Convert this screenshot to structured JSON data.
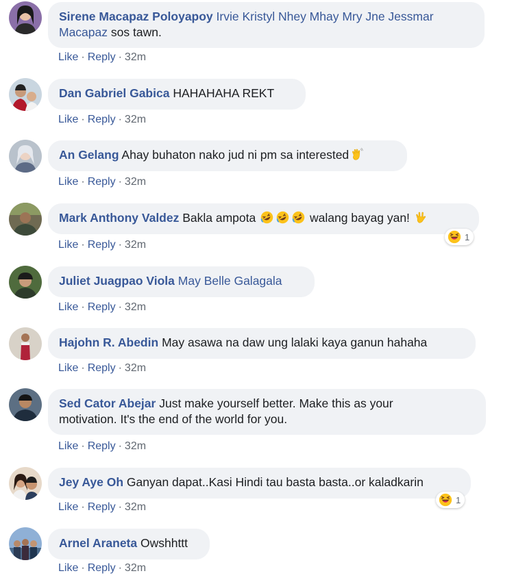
{
  "comments": [
    {
      "author": "Sirene Macapaz Poloyapoy",
      "tag": "Irvie Kristyl Nhey Mhay Mry Jne Jessmar Macapaz",
      "text": " sos tawn.",
      "like": "Like",
      "reply": "Reply",
      "time": "32m"
    },
    {
      "author": "Dan Gabriel Gabica",
      "text": "HAHAHAHA REKT",
      "like": "Like",
      "reply": "Reply",
      "time": "32m"
    },
    {
      "author": "An Gelang",
      "text": "Ahay buhaton nako jud ni pm sa interested",
      "emoji": "waving-hand",
      "like": "Like",
      "reply": "Reply",
      "time": "32m"
    },
    {
      "author": "Mark Anthony Valdez",
      "text_before": "Bakla ampota ",
      "emojis": [
        "rofl",
        "rofl",
        "rofl"
      ],
      "text_after": " walang bayag yan! ",
      "end_emoji": "love-you-gesture",
      "reaction": {
        "type": "haha",
        "count": "1"
      },
      "like": "Like",
      "reply": "Reply",
      "time": "32m"
    },
    {
      "author": "Juliet Juagpao Viola",
      "tag": "May Belle Galagala",
      "like": "Like",
      "reply": "Reply",
      "time": "32m"
    },
    {
      "author": "Hajohn R. Abedin",
      "text": "May asawa na daw ung lalaki kaya ganun hahaha",
      "like": "Like",
      "reply": "Reply",
      "time": "32m"
    },
    {
      "author": "Sed Cator Abejar",
      "text_line1": "Just make yourself better. Make this as your",
      "text_line2": "motivation. It's the end of the world for you.",
      "like": "Like",
      "reply": "Reply",
      "time": "32m"
    },
    {
      "author": "Jey Aye Oh",
      "text": "Ganyan dapat..Kasi Hindi tau basta basta..or kaladkarin",
      "reaction": {
        "type": "haha",
        "count": "1"
      },
      "like": "Like",
      "reply": "Reply",
      "time": "32m"
    },
    {
      "author": "Arnel Araneta",
      "text": "Owshhttt",
      "like": "Like",
      "reply": "Reply",
      "time": "32m"
    }
  ],
  "colors": {
    "link": "#385898",
    "bubble": "#f0f2f5",
    "meta": "#606770"
  }
}
